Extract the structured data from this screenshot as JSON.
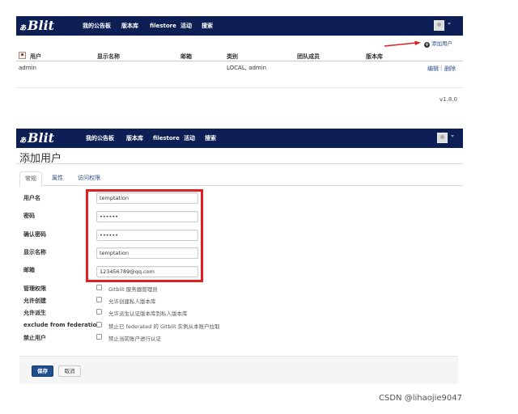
{
  "nav": {
    "logo_prefix": "ぁ",
    "logo": "Blit",
    "items": [
      "我的公告板",
      "版本库",
      "filestore",
      "活动",
      "搜索"
    ]
  },
  "panel1": {
    "add_user_label": "添加用户",
    "table": {
      "headers": [
        "用户",
        "显示名称",
        "邮箱",
        "类别",
        "团队成员",
        "版本库"
      ],
      "rows": [
        {
          "user": "admin",
          "display_name": "",
          "email": "",
          "category": "LOCAL, admin",
          "team": "",
          "repos": "",
          "edit": "编辑",
          "divider": "|",
          "delete": "删除"
        }
      ]
    },
    "version": "v1.8.0"
  },
  "panel2": {
    "title": "添加用户",
    "tabs": [
      "常规",
      "属性",
      "访问权限"
    ],
    "active_tab": "常规",
    "fields": [
      {
        "label": "用户名",
        "value": "temptation"
      },
      {
        "label": "密码",
        "value": "••••••"
      },
      {
        "label": "确认密码",
        "value": "••••••"
      },
      {
        "label": "显示名称",
        "value": "temptation"
      },
      {
        "label": "邮箱",
        "value": "123456789@qq.com"
      }
    ],
    "checkboxes": [
      {
        "label": "管理权限",
        "text": "Gitblit 服务器管理员",
        "checked": false
      },
      {
        "label": "允许创建",
        "text": "允许创建私人版本库",
        "checked": false
      },
      {
        "label": "允许派生",
        "text": "允许派生认证版本库到私人版本库",
        "checked": false
      },
      {
        "label": "exclude from federation",
        "text": "禁止已 federated 的 Gitblit 实例从本账户拉取",
        "checked": false
      },
      {
        "label": "禁止用户",
        "text": "禁止当前账户进行认证",
        "checked": false
      }
    ],
    "save_label": "保存",
    "cancel_label": "取消"
  },
  "watermark": "CSDN @lihaojie9047",
  "colors": {
    "navbar": "#0d1f54",
    "link": "#2a4f8f",
    "highlight": "#e02020",
    "save_button": "#1f4e8c"
  }
}
